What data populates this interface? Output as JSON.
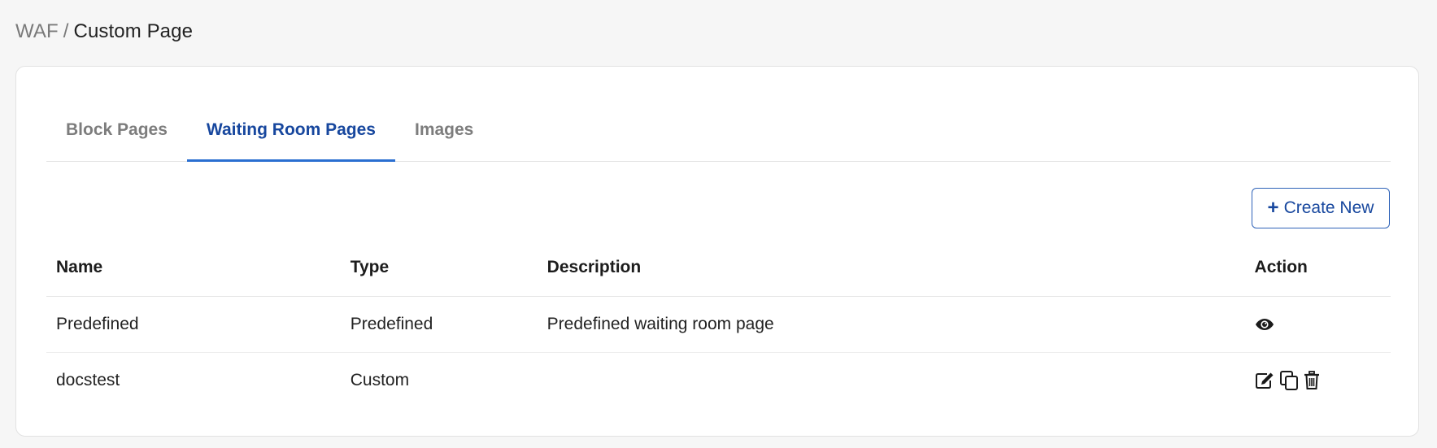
{
  "breadcrumb": {
    "parent": "WAF",
    "separator": "/",
    "current": "Custom Page"
  },
  "tabs": [
    {
      "label": "Block Pages",
      "active": false
    },
    {
      "label": "Waiting Room Pages",
      "active": true
    },
    {
      "label": "Images",
      "active": false
    }
  ],
  "toolbar": {
    "create_label": "Create New",
    "create_icon": "plus-icon"
  },
  "table": {
    "headers": {
      "name": "Name",
      "type": "Type",
      "description": "Description",
      "action": "Action"
    },
    "rows": [
      {
        "name": "Predefined",
        "type": "Predefined",
        "description": "Predefined waiting room page",
        "actions": [
          "eye-icon"
        ]
      },
      {
        "name": "docstest",
        "type": "Custom",
        "description": "",
        "actions": [
          "edit-icon",
          "copy-icon",
          "trash-icon"
        ]
      }
    ]
  },
  "colors": {
    "accent": "#17479e",
    "tab_underline": "#2a6fd1",
    "muted_text": "#7d7d7d",
    "page_bg": "#f6f6f6"
  }
}
